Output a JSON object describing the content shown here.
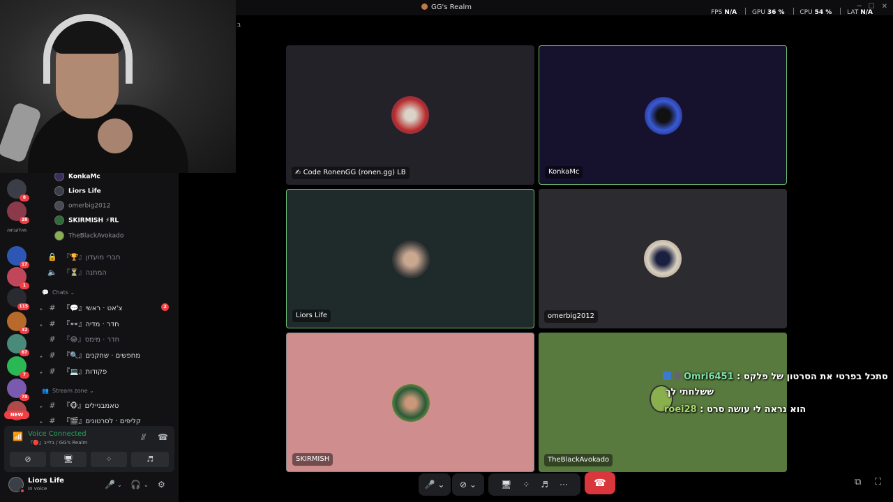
{
  "window": {
    "title": "GG's Realm",
    "stats": {
      "fps_label": "FPS",
      "fps_value": "N/A",
      "gpu_label": "GPU",
      "gpu_value": "36 %",
      "cpu_label": "CPU",
      "cpu_value": "54 %",
      "lat_label": "LAT",
      "lat_value": "N/A"
    }
  },
  "stage_label": "ב",
  "server_badges": [
    "8",
    "28",
    "17",
    "1",
    "115",
    "32",
    "67",
    "7",
    "78"
  ],
  "server_text": "מהלקביצה",
  "new_badge": "NEW",
  "members": [
    {
      "name": "KonkaMc",
      "active": true
    },
    {
      "name": "Liors Life",
      "active": true
    },
    {
      "name": "omerbig2012",
      "active": false
    },
    {
      "name": "SKIRMISH ⚡RL",
      "active": true
    },
    {
      "name": "TheBlackAvokado",
      "active": false
    }
  ],
  "locked_channels": [
    {
      "label": "『🏆』חברי מועדון"
    },
    {
      "label": "『⏳』המתנה"
    }
  ],
  "categories": {
    "chats": "Chats",
    "stream": "Stream zone"
  },
  "channels": [
    {
      "label": "『💬』צ'אט · ראשי",
      "count": "2"
    },
    {
      "label": "『👓』חדר · מדיה",
      "count": ""
    },
    {
      "label": "『😂』חדר · מימס",
      "count": ""
    },
    {
      "label": "『🔍』מחפשים · שחקנים",
      "count": ""
    },
    {
      "label": "『💻』פקודות",
      "count": ""
    },
    {
      "label": "『🐵』טאמבניילים",
      "count": ""
    },
    {
      "label": "『🎬』קליפים · לסרטונים",
      "count": ""
    }
  ],
  "voice": {
    "status": "Voice Connected",
    "sub": "『🔴』בלייב / GG's Realm"
  },
  "user": {
    "name": "Liors Life",
    "status": "In voice"
  },
  "tiles": [
    {
      "name": "Code RonenGG (ronen.gg) LB",
      "bg": "#232229"
    },
    {
      "name": "KonkaMc",
      "bg": "#16112d"
    },
    {
      "name": "Liors Life",
      "bg": "#1f2a2b"
    },
    {
      "name": "omerbig2012",
      "bg": "#2b2b30"
    },
    {
      "name": "SKIRMISH",
      "bg": "#d08d8e"
    },
    {
      "name": "TheBlackAvokado",
      "bg": "#597a3e"
    }
  ],
  "overlay_chat": [
    {
      "user": "Omri6451",
      "sep": " : ",
      "message": "סתכל בפרטי את הסרטון של פלקס",
      "cont": "ששלחתי לך"
    },
    {
      "user": "roei28",
      "sep": " : ",
      "message": "הוא נראה לי עושה סרט",
      "cont": ""
    }
  ],
  "colors": {
    "accent_green": "#23a55a",
    "danger": "#da373c",
    "speaking": "#6fbf73"
  }
}
